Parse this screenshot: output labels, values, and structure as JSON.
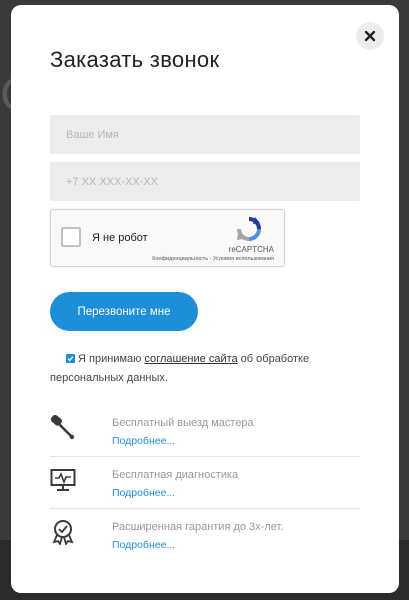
{
  "modal": {
    "title": "Заказать звонок",
    "close_label": "✕"
  },
  "form": {
    "name_placeholder": "Ваше Имя",
    "phone_placeholder": "+7 XX XXX-XX-XX",
    "submit_label": "Перезвоните мне"
  },
  "recaptcha": {
    "label": "Я не робот",
    "brand": "reCAPTCHA",
    "links": "Конфиденциальность - Условия использования"
  },
  "consent": {
    "before": "Я принимаю ",
    "link": "соглашение сайта",
    "after": " об обработке",
    "line2": "персональных данных."
  },
  "features": [
    {
      "icon": "screwdriver-icon",
      "title": "Бесплатный выезд мастера",
      "more": "Подробнее..."
    },
    {
      "icon": "monitor-diagnostics-icon",
      "title": "Бесплатная диагностика",
      "more": "Подробнее..."
    },
    {
      "icon": "warranty-badge-icon",
      "title": "Расширенная гарантия до 3х-лет.",
      "more": "Подробнее..."
    }
  ],
  "colors": {
    "accent": "#1d8fd8",
    "field_bg": "#ececec",
    "overlay": "#3a3a3a"
  }
}
